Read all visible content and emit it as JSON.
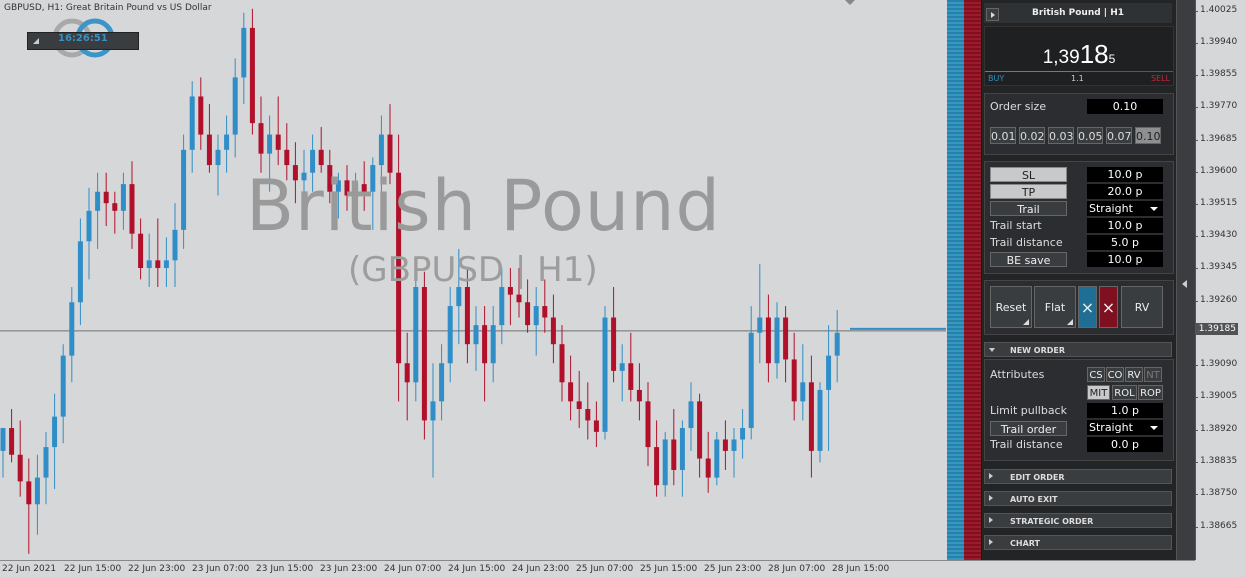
{
  "chart": {
    "title": "GBPUSD, H1:  Great Britain Pound vs US Dollar",
    "clock": "16:26:51",
    "watermark_title": "British Pound",
    "watermark_sub": "(GBPUSD | H1)",
    "current_price": "1.39185",
    "price_ticks": [
      "1.40025",
      "1.39940",
      "1.39855",
      "1.39770",
      "1.39685",
      "1.39600",
      "1.39515",
      "1.39430",
      "1.39345",
      "1.39260",
      "1.39175",
      "1.39090",
      "1.39005",
      "1.38920",
      "1.38835",
      "1.38750",
      "1.38665"
    ],
    "time_ticks": [
      "22 Jun 2021",
      "22 Jun 15:00",
      "22 Jun 23:00",
      "23 Jun 07:00",
      "23 Jun 15:00",
      "23 Jun 23:00",
      "24 Jun 07:00",
      "24 Jun 15:00",
      "24 Jun 23:00",
      "25 Jun 07:00",
      "25 Jun 15:00",
      "25 Jun 23:00",
      "28 Jun 07:00",
      "28 Jun 15:00"
    ],
    "colors": {
      "bull": "#2f8ec7",
      "bear": "#b0102a",
      "bg": "#d6d7d9"
    }
  },
  "chart_data": {
    "type": "candlestick",
    "ylim": [
      1.3861,
      1.4004
    ],
    "candles": [
      [
        1.3887,
        1.3893,
        1.388,
        1.3893
      ],
      [
        1.3893,
        1.3898,
        1.3884,
        1.3886
      ],
      [
        1.3886,
        1.3895,
        1.3875,
        1.3879
      ],
      [
        1.3879,
        1.3885,
        1.386,
        1.3873
      ],
      [
        1.3873,
        1.3886,
        1.3865,
        1.388
      ],
      [
        1.388,
        1.3892,
        1.3873,
        1.3888
      ],
      [
        1.3888,
        1.3902,
        1.3877,
        1.3896
      ],
      [
        1.3896,
        1.3915,
        1.3889,
        1.3912
      ],
      [
        1.3912,
        1.393,
        1.3905,
        1.3926
      ],
      [
        1.3926,
        1.3948,
        1.392,
        1.3942
      ],
      [
        1.3942,
        1.3956,
        1.3932,
        1.395
      ],
      [
        1.395,
        1.396,
        1.394,
        1.3955
      ],
      [
        1.3955,
        1.396,
        1.3946,
        1.3952
      ],
      [
        1.3952,
        1.3955,
        1.3944,
        1.395
      ],
      [
        1.395,
        1.396,
        1.3945,
        1.3957
      ],
      [
        1.3957,
        1.3963,
        1.394,
        1.3944
      ],
      [
        1.3944,
        1.3948,
        1.3932,
        1.3935
      ],
      [
        1.3935,
        1.3944,
        1.393,
        1.3937
      ],
      [
        1.3937,
        1.3948,
        1.393,
        1.3935
      ],
      [
        1.3935,
        1.3943,
        1.393,
        1.3937
      ],
      [
        1.3937,
        1.3952,
        1.393,
        1.3945
      ],
      [
        1.3945,
        1.397,
        1.394,
        1.3966
      ],
      [
        1.3966,
        1.3984,
        1.396,
        1.398
      ],
      [
        1.398,
        1.3985,
        1.3966,
        1.397
      ],
      [
        1.397,
        1.3978,
        1.396,
        1.3962
      ],
      [
        1.3962,
        1.397,
        1.3954,
        1.3966
      ],
      [
        1.3966,
        1.3975,
        1.396,
        1.397
      ],
      [
        1.397,
        1.399,
        1.3964,
        1.3985
      ],
      [
        1.3985,
        1.4002,
        1.3978,
        1.3998
      ],
      [
        1.3998,
        1.4003,
        1.397,
        1.3973
      ],
      [
        1.3973,
        1.398,
        1.396,
        1.3965
      ],
      [
        1.3965,
        1.3975,
        1.3955,
        1.397
      ],
      [
        1.397,
        1.398,
        1.3962,
        1.3966
      ],
      [
        1.3966,
        1.3973,
        1.3958,
        1.3962
      ],
      [
        1.3962,
        1.3968,
        1.3952,
        1.3958
      ],
      [
        1.3958,
        1.3966,
        1.395,
        1.396
      ],
      [
        1.396,
        1.397,
        1.3955,
        1.3966
      ],
      [
        1.3966,
        1.3972,
        1.396,
        1.3962
      ],
      [
        1.3962,
        1.3966,
        1.3952,
        1.3955
      ],
      [
        1.3955,
        1.396,
        1.3948,
        1.3958
      ],
      [
        1.3958,
        1.3962,
        1.395,
        1.3954
      ],
      [
        1.3954,
        1.396,
        1.3948,
        1.3957
      ],
      [
        1.3957,
        1.3963,
        1.395,
        1.3955
      ],
      [
        1.3955,
        1.3964,
        1.3945,
        1.3962
      ],
      [
        1.3962,
        1.3975,
        1.3954,
        1.397
      ],
      [
        1.397,
        1.3978,
        1.3957,
        1.396
      ],
      [
        1.396,
        1.397,
        1.39,
        1.391
      ],
      [
        1.391,
        1.3918,
        1.3895,
        1.3905
      ],
      [
        1.3905,
        1.3935,
        1.39,
        1.393
      ],
      [
        1.393,
        1.3934,
        1.389,
        1.3895
      ],
      [
        1.3895,
        1.391,
        1.388,
        1.39
      ],
      [
        1.39,
        1.3915,
        1.3895,
        1.391
      ],
      [
        1.391,
        1.393,
        1.3905,
        1.3925
      ],
      [
        1.3925,
        1.394,
        1.3915,
        1.393
      ],
      [
        1.393,
        1.3935,
        1.391,
        1.3915
      ],
      [
        1.3915,
        1.3925,
        1.3908,
        1.392
      ],
      [
        1.392,
        1.3925,
        1.39,
        1.391
      ],
      [
        1.391,
        1.3925,
        1.3905,
        1.392
      ],
      [
        1.392,
        1.3935,
        1.3915,
        1.393
      ],
      [
        1.393,
        1.3935,
        1.392,
        1.3928
      ],
      [
        1.3928,
        1.3935,
        1.3922,
        1.3926
      ],
      [
        1.3926,
        1.3932,
        1.3918,
        1.392
      ],
      [
        1.392,
        1.393,
        1.3912,
        1.3925
      ],
      [
        1.3925,
        1.3932,
        1.3918,
        1.3922
      ],
      [
        1.3922,
        1.3928,
        1.391,
        1.3915
      ],
      [
        1.3915,
        1.392,
        1.39,
        1.3905
      ],
      [
        1.3905,
        1.3912,
        1.3895,
        1.39
      ],
      [
        1.39,
        1.3908,
        1.3893,
        1.3898
      ],
      [
        1.3898,
        1.3905,
        1.389,
        1.3895
      ],
      [
        1.3895,
        1.39,
        1.3888,
        1.3892
      ],
      [
        1.3892,
        1.3925,
        1.389,
        1.3922
      ],
      [
        1.3922,
        1.393,
        1.3905,
        1.3908
      ],
      [
        1.3908,
        1.3915,
        1.39,
        1.391
      ],
      [
        1.391,
        1.3918,
        1.39,
        1.3903
      ],
      [
        1.3903,
        1.391,
        1.3895,
        1.39
      ],
      [
        1.39,
        1.3905,
        1.3883,
        1.3888
      ],
      [
        1.3888,
        1.3895,
        1.3875,
        1.3878
      ],
      [
        1.3878,
        1.3892,
        1.3875,
        1.389
      ],
      [
        1.389,
        1.3898,
        1.3878,
        1.3882
      ],
      [
        1.3882,
        1.3895,
        1.3875,
        1.3893
      ],
      [
        1.3893,
        1.3905,
        1.3887,
        1.39
      ],
      [
        1.39,
        1.3902,
        1.388,
        1.3885
      ],
      [
        1.3885,
        1.3892,
        1.3876,
        1.388
      ],
      [
        1.388,
        1.3892,
        1.3878,
        1.389
      ],
      [
        1.389,
        1.3895,
        1.3882,
        1.3887
      ],
      [
        1.3887,
        1.3893,
        1.388,
        1.389
      ],
      [
        1.389,
        1.3898,
        1.3885,
        1.3893
      ],
      [
        1.3893,
        1.3925,
        1.389,
        1.3918
      ],
      [
        1.3918,
        1.3936,
        1.391,
        1.3922
      ],
      [
        1.3922,
        1.3928,
        1.3905,
        1.391
      ],
      [
        1.391,
        1.3926,
        1.3906,
        1.3922
      ],
      [
        1.3922,
        1.3925,
        1.3905,
        1.3911
      ],
      [
        1.3911,
        1.3918,
        1.3895,
        1.39
      ],
      [
        1.39,
        1.3915,
        1.3895,
        1.3905
      ],
      [
        1.3905,
        1.3912,
        1.388,
        1.3887
      ],
      [
        1.3887,
        1.3905,
        1.3884,
        1.3903
      ],
      [
        1.3903,
        1.392,
        1.3887,
        1.3912
      ],
      [
        1.3912,
        1.3924,
        1.3905,
        1.3918
      ]
    ]
  },
  "panel": {
    "header": "British Pound | H1",
    "price_main": "1,39",
    "price_big": "18",
    "price_small": "5",
    "buy_label": "BUY",
    "sell_label": "SELL",
    "spread": "1.1",
    "order_size_label": "Order size",
    "order_size": "0.10",
    "lots": [
      "0.01",
      "0.02",
      "0.03",
      "0.05",
      "0.07",
      "0.10"
    ],
    "sl_label": "SL",
    "sl_value": "10.0 p",
    "tp_label": "TP",
    "tp_value": "20.0 p",
    "trail_label": "Trail",
    "trail_mode": "Straight",
    "trail_start_label": "Trail start",
    "trail_start_value": "10.0 p",
    "trail_distance_label": "Trail distance",
    "trail_distance_value": "5.0 p",
    "be_save_label": "BE save",
    "be_save_value": "10.0 p",
    "reset_label": "Reset",
    "flat_label": "Flat",
    "rv_label": "RV",
    "close_buy_label": "×",
    "close_sell_label": "×",
    "new_order_header": "NEW ORDER",
    "attributes_label": "Attributes",
    "attrs_row1": [
      "CS",
      "CO",
      "RV",
      "NT"
    ],
    "attrs_row2": [
      "MIT",
      "ROL",
      "ROP"
    ],
    "limit_pullback_label": "Limit pullback",
    "limit_pullback_value": "1.0 p",
    "trail_order_label": "Trail order",
    "trail_order_mode": "Straight",
    "trail_distance2_label": "Trail distance",
    "trail_distance2_value": "0.0 p",
    "sections": [
      "EDIT ORDER",
      "AUTO EXIT",
      "STRATEGIC ORDER",
      "CHART"
    ]
  }
}
